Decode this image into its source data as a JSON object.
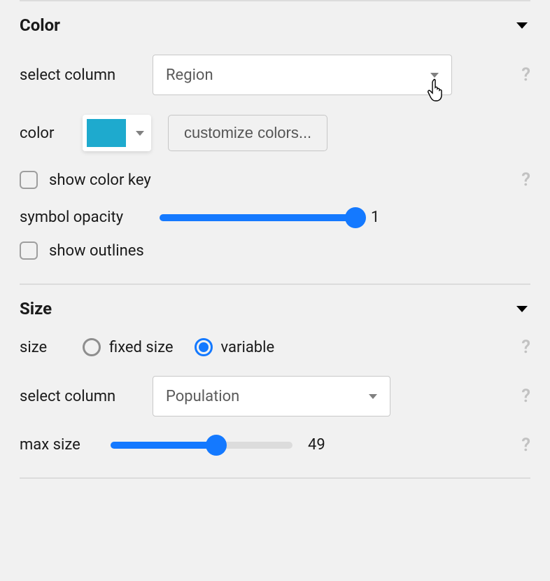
{
  "colorSection": {
    "title": "Color",
    "selectColumn": {
      "label": "select column",
      "value": "Region"
    },
    "color": {
      "label": "color",
      "swatchHex": "#1eaace",
      "customizeLabel": "customize colors..."
    },
    "showColorKey": {
      "label": "show color key",
      "checked": false
    },
    "symbolOpacity": {
      "label": "symbol opacity",
      "value": 1,
      "min": 0,
      "max": 1,
      "display": "1"
    },
    "showOutlines": {
      "label": "show outlines",
      "checked": false
    }
  },
  "sizeSection": {
    "title": "Size",
    "size": {
      "label": "size",
      "options": [
        "fixed size",
        "variable"
      ],
      "selected": "variable"
    },
    "selectColumn": {
      "label": "select column",
      "value": "Population"
    },
    "maxSize": {
      "label": "max size",
      "value": 49,
      "min": 0,
      "max": 100,
      "display": "49"
    }
  },
  "ui": {
    "helpGlyph": "?"
  }
}
